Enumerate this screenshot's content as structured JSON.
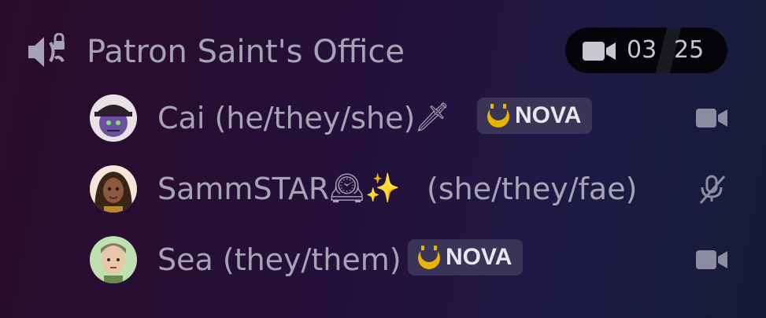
{
  "channel": {
    "name": "Patron Saint's Office",
    "icon": "speaker-lock-icon",
    "video_count": "03",
    "member_limit": "25"
  },
  "users": [
    {
      "name": "Cai (he/they/she)",
      "emoji": "🗡",
      "badge": "NOVA",
      "status_icon": "video-camera-icon"
    },
    {
      "name": "SammSTAR",
      "emoji": "🕰✨",
      "pronouns": "(she/they/fae)",
      "status_icon": "mic-muted-icon"
    },
    {
      "name": "Sea (they/them)",
      "badge": "NOVA",
      "status_icon": "video-camera-icon"
    }
  ],
  "colors": {
    "badge_bg": "#3a3457",
    "counter_bg": "#050509",
    "text": "#a7a3b6",
    "moon": "#e8b400"
  }
}
